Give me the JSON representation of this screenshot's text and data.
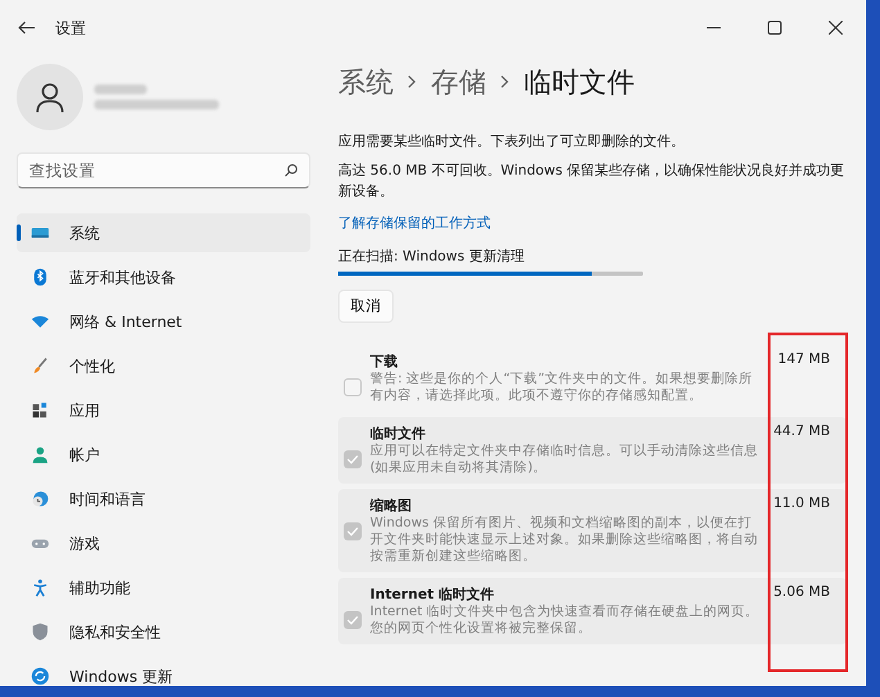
{
  "window": {
    "title": "设置"
  },
  "search": {
    "placeholder": "查找设置"
  },
  "sidebar": {
    "items": [
      {
        "label": "系统",
        "selected": true
      },
      {
        "label": "蓝牙和其他设备",
        "selected": false
      },
      {
        "label": "网络 & Internet",
        "selected": false
      },
      {
        "label": "个性化",
        "selected": false
      },
      {
        "label": "应用",
        "selected": false
      },
      {
        "label": "帐户",
        "selected": false
      },
      {
        "label": "时间和语言",
        "selected": false
      },
      {
        "label": "游戏",
        "selected": false
      },
      {
        "label": "辅助功能",
        "selected": false
      },
      {
        "label": "隐私和安全性",
        "selected": false
      },
      {
        "label": "Windows 更新",
        "selected": false
      }
    ]
  },
  "breadcrumb": [
    "系统",
    "存储",
    "临时文件"
  ],
  "intro": "应用需要某些临时文件。下表列出了可立即删除的文件。",
  "reserved": "高达 56.0 MB 不可回收。Windows 保留某些存储，以确保性能状况良好并成功更新设备。",
  "link": "了解存储保留的工作方式",
  "scan": {
    "label": "正在扫描: Windows 更新清理",
    "level": 0.83
  },
  "cancel_button": "取消",
  "items": [
    {
      "title": "下载",
      "size": "147 MB",
      "description": "警告: 这些是你的个人“下载”文件夹中的文件。如果想要删除所有内容，请选择此项。此项不遵守你的存储感知配置。",
      "checked": false
    },
    {
      "title": "临时文件",
      "size": "44.7 MB",
      "description": "应用可以在特定文件夹中存储临时信息。可以手动清除这些信息(如果应用未自动将其清除)。",
      "checked": true
    },
    {
      "title": "缩略图",
      "size": "11.0 MB",
      "description": "Windows 保留所有图片、视频和文档缩略图的副本，以便在打开文件夹时能快速显示上述对象。如果删除这些缩略图，将自动按需重新创建这些缩略图。",
      "checked": true
    },
    {
      "title": "Internet 临时文件",
      "size": "5.06 MB",
      "description": "Internet 临时文件夹中包含为快速查看而存储在硬盘上的网页。您的网页个性化设置将被完整保留。",
      "checked": true
    }
  ]
}
